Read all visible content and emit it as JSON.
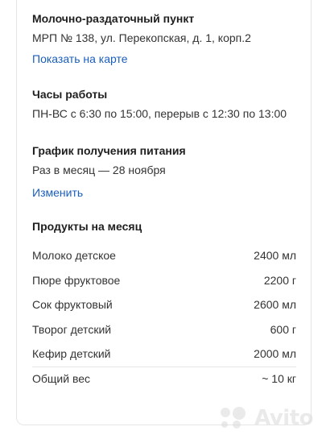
{
  "point": {
    "title": "Молочно-раздаточный пункт",
    "address": "МРП № 138, ул. Перекопская, д. 1, корп.2",
    "map_link": "Показать на карте"
  },
  "hours": {
    "title": "Часы работы",
    "text": "ПН-ВС с 6:30 по 15:00, перерыв с 12:30 по 13:00"
  },
  "schedule": {
    "title": "График получения питания",
    "text": "Раз в месяц — 28 ноября",
    "edit_link": "Изменить"
  },
  "products": {
    "title": "Продукты на месяц",
    "rows": [
      {
        "name": "Молоко детское",
        "value": "2400 мл"
      },
      {
        "name": "Пюре фруктовое",
        "value": "2200 г"
      },
      {
        "name": "Сок фруктовый",
        "value": "2600 мл"
      },
      {
        "name": "Творог детский",
        "value": "600 г"
      },
      {
        "name": "Кефир детский",
        "value": "2000 мл"
      }
    ],
    "total": {
      "name": "Общий вес",
      "value": "~ 10 кг"
    }
  },
  "watermark": {
    "text": "Avito",
    "icon": "avito-dots-icon",
    "color": "#d9d9d9"
  },
  "colors": {
    "link": "#1a5ebd",
    "text": "#1f1f1f",
    "divider": "#e6e6e6"
  }
}
